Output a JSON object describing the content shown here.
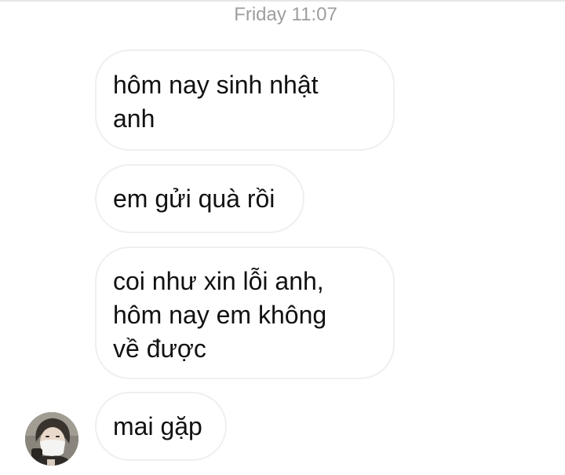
{
  "conversation": {
    "timestamp": "Friday 11:07",
    "messages": [
      {
        "text": "hôm nay sinh nhật\nanh"
      },
      {
        "text": "em gửi quà rồi"
      },
      {
        "text": "coi như xin lỗi anh,\nhôm nay em không\nvề được"
      },
      {
        "text": "mai gặp"
      }
    ],
    "sender_avatar": {
      "icon": "profile-photo"
    }
  }
}
